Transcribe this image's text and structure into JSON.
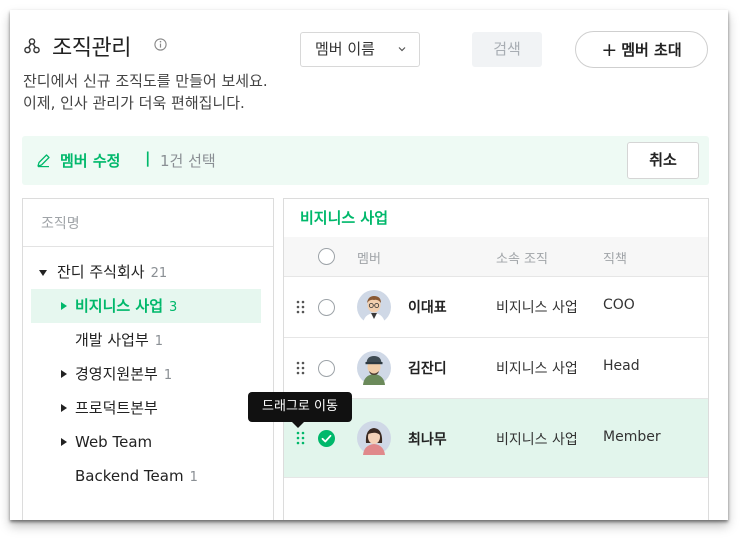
{
  "header": {
    "title": "조직관리",
    "description_line1": "잔디에서 신규 조직도를 만들어 보세요.",
    "description_line2": "이제, 인사 관리가 더욱 편해집니다.",
    "search_select_value": "멤버 이름",
    "search_button_label": "검색",
    "invite_button_plus": "+",
    "invite_button_label": "멤버 초대"
  },
  "edit_bar": {
    "label": "멤버 수정",
    "separator": "|",
    "selection_count": "1건 선택",
    "cancel_label": "취소"
  },
  "tree": {
    "header": "조직명",
    "items": [
      {
        "label": "잔디 주식회사",
        "count": "21",
        "state": "expanded"
      },
      {
        "label": "비지니스 사업",
        "count": "3",
        "state": "selected"
      },
      {
        "label": "개발 사업부",
        "count": "1",
        "state": "leaf"
      },
      {
        "label": "경영지원본부",
        "count": "1",
        "state": "collapsed"
      },
      {
        "label": "프로덕트본부",
        "count": "",
        "state": "collapsed"
      },
      {
        "label": "Web Team",
        "count": "",
        "state": "collapsed"
      },
      {
        "label": "Backend Team",
        "count": "1",
        "state": "leaf"
      }
    ]
  },
  "members": {
    "department_title": "비지니스 사업",
    "columns": {
      "member": "멤버",
      "department": "소속 조직",
      "title": "직책"
    },
    "rows": [
      {
        "name": "이대표",
        "department": "비지니스 사업",
        "title": "COO",
        "selected": false,
        "avatar": "male-avatar-glasses"
      },
      {
        "name": "김잔디",
        "department": "비지니스 사업",
        "title": "Head",
        "selected": false,
        "avatar": "male-avatar-cap"
      },
      {
        "name": "최나무",
        "department": "비지니스 사업",
        "title": "Member",
        "selected": true,
        "avatar": "female-avatar"
      }
    ]
  },
  "tooltip": {
    "text": "드래그로 이동"
  },
  "colors": {
    "accent": "#00b86b",
    "accent_bg": "#eefaf4",
    "selected_row_bg": "#e2f5ec",
    "tooltip_bg": "#111111"
  }
}
